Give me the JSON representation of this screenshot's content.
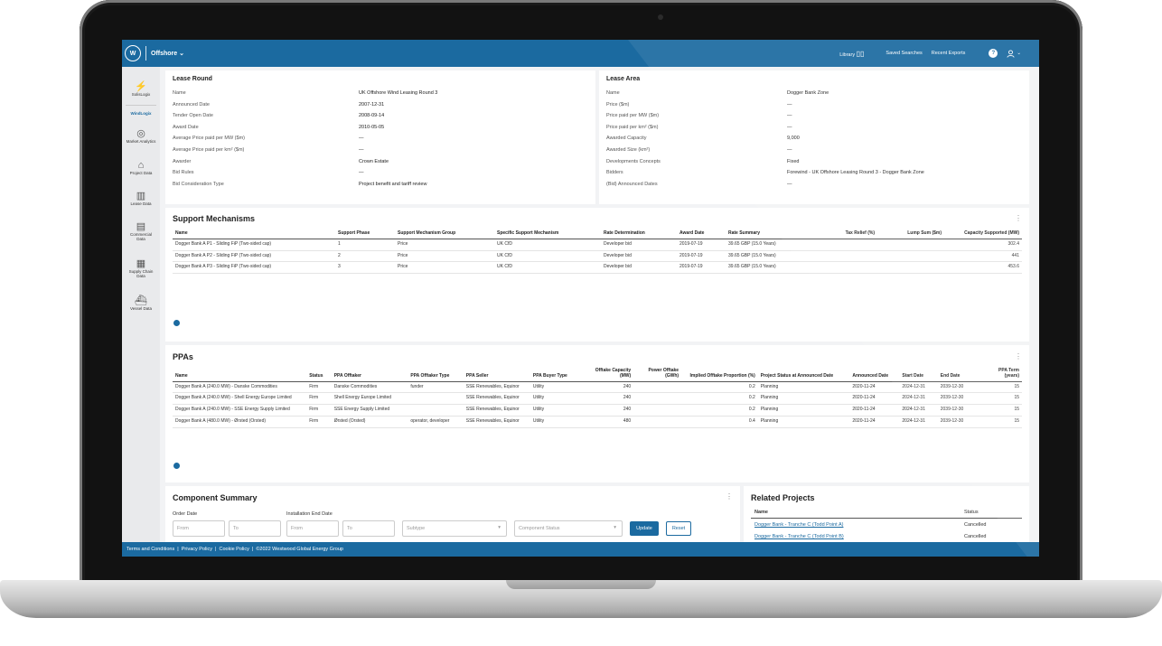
{
  "header": {
    "logo": "W",
    "app_name": "Offshore ⌄",
    "library": "Library",
    "saved_searches": "Saved Searches",
    "recent_exports": "Recent Exports",
    "help": "?",
    "user": "⌄"
  },
  "sidebar": {
    "items": [
      {
        "label": "SolisLogix",
        "icon": "solar-icon"
      },
      {
        "label": "WindLogix",
        "icon": ""
      },
      {
        "label": "Market Analytics",
        "icon": "analytics-icon"
      },
      {
        "label": "Project Data",
        "icon": "project-icon"
      },
      {
        "label": "Lease Data",
        "icon": "map-icon"
      },
      {
        "label": "Commercial Data",
        "icon": "document-icon"
      },
      {
        "label": "Supply Chain Data",
        "icon": "supply-chain-icon"
      },
      {
        "label": "Vessel Data",
        "icon": "vessel-icon"
      }
    ]
  },
  "lease_round": {
    "title": "Lease Round",
    "rows": [
      {
        "k": "Name",
        "v": "UK Offshore Wind Leasing Round 3"
      },
      {
        "k": "Announced Date",
        "v": "2007-12-31"
      },
      {
        "k": "Tender Open Date",
        "v": "2008-09-14"
      },
      {
        "k": "Award Date",
        "v": "2010-05-05"
      },
      {
        "k": "Average Price paid per MW ($m)",
        "v": "—"
      },
      {
        "k": "Average Price paid per km² ($m)",
        "v": "—"
      },
      {
        "k": "Awarder",
        "v": "Crown Estate"
      },
      {
        "k": "Bid Rules",
        "v": "—"
      },
      {
        "k": "Bid Consideration Type",
        "v": "Project benefit and tariff review"
      }
    ]
  },
  "lease_area": {
    "title": "Lease Area",
    "rows": [
      {
        "k": "Name",
        "v": "Dogger Bank Zone"
      },
      {
        "k": "Price ($m)",
        "v": "—"
      },
      {
        "k": "Price paid per MW ($m)",
        "v": "—"
      },
      {
        "k": "Price paid per km² ($m)",
        "v": "—"
      },
      {
        "k": "Awarded Capacity",
        "v": "9,000"
      },
      {
        "k": "Awarded Size (km²)",
        "v": "—"
      },
      {
        "k": "Developments Concepts",
        "v": "Fixed"
      },
      {
        "k": "Bidders",
        "v": "Forewind - UK Offshore Leasing Round 3 - Dogger Bank Zone"
      },
      {
        "k": "(Bid) Announced Dates",
        "v": "—"
      }
    ]
  },
  "support": {
    "title": "Support Mechanisms",
    "kebab": "⋮",
    "headers": [
      "Name",
      "Support Phase",
      "Support Mechanism Group",
      "Specific Support Mechanism",
      "Rate Determination",
      "Award Date",
      "Rate Summary",
      "Tax Relief (%)",
      "Lump Sum ($m)",
      "Capacity Supported (MW)"
    ],
    "rows": [
      [
        "Dogger Bank A P1 - Sliding FiP (Two-sided cap)",
        "1",
        "Price",
        "UK CfD",
        "Developer bid",
        "2019-07-19",
        "39.65 GBP (15.0 Years)",
        "",
        "",
        "302.4"
      ],
      [
        "Dogger Bank A P2 - Sliding FiP (Two-sided cap)",
        "2",
        "Price",
        "UK CfD",
        "Developer bid",
        "2019-07-19",
        "39.65 GBP (15.0 Years)",
        "",
        "",
        "441"
      ],
      [
        "Dogger Bank A P3 - Sliding FiP (Two-sided cap)",
        "3",
        "Price",
        "UK CfD",
        "Developer bid",
        "2019-07-19",
        "39.65 GBP (15.0 Years)",
        "",
        "",
        "453.6"
      ]
    ]
  },
  "ppas": {
    "title": "PPAs",
    "kebab": "⋮",
    "headers": [
      "Name",
      "Status",
      "PPA Offtaker",
      "PPA Offtaker Type",
      "PPA Seller",
      "PPA Buyer Type",
      "Offtake Capacity (MW)",
      "Power Offtake (GWh)",
      "Implied Offtake Proportion (%)",
      "Project Status at Announced Date",
      "Announced Date",
      "Start Date",
      "End Date",
      "PPA Term (years)"
    ],
    "rows": [
      [
        "Dogger Bank A (240.0 MW) - Danske Commodities",
        "Firm",
        "Danske Commodities",
        "funder",
        "SSE Renewables, Equinor",
        "Utility",
        "240",
        "",
        "0.2",
        "Planning",
        "2020-11-24",
        "2024-12-31",
        "2039-12-30",
        "15"
      ],
      [
        "Dogger Bank A (240.0 MW) - Shell Energy Europe Limited",
        "Firm",
        "Shell Energy Europe Limited",
        "",
        "SSE Renewables, Equinor",
        "Utility",
        "240",
        "",
        "0.2",
        "Planning",
        "2020-11-24",
        "2024-12-31",
        "2039-12-30",
        "15"
      ],
      [
        "Dogger Bank A (240.0 MW) - SSE Energy Supply Limited",
        "Firm",
        "SSE Energy Supply Limited",
        "",
        "SSE Renewables, Equinor",
        "Utility",
        "240",
        "",
        "0.2",
        "Planning",
        "2020-11-24",
        "2024-12-31",
        "2039-12-30",
        "15"
      ],
      [
        "Dogger Bank A (480.0 MW) - Ørsted (Orsted)",
        "Firm",
        "Ørsted (Orsted)",
        "operator, developer",
        "SSE Renewables, Equinor",
        "Utility",
        "480",
        "",
        "0.4",
        "Planning",
        "2020-11-24",
        "2024-12-31",
        "2039-12-30",
        "15"
      ]
    ]
  },
  "component": {
    "title": "Component Summary",
    "kebab": "⋮",
    "order_date": "Order Date",
    "install_end": "Installation End Date",
    "from": "From",
    "to": "To",
    "subtype": "Subtype",
    "status": "Component Status",
    "update": "Update",
    "reset": "Reset"
  },
  "related": {
    "title": "Related Projects",
    "col_name": "Name",
    "col_status": "Status",
    "rows": [
      {
        "name": "Dogger Bank - Tranche C (Todd Point A)",
        "status": "Cancelled"
      },
      {
        "name": "Dogger Bank - Tranche C (Todd Point B)",
        "status": "Cancelled"
      }
    ]
  },
  "footer": {
    "text": "Terms and Conditions  |  Privacy Policy  |  Cookie Policy  |  ©2022 Westwood Global Energy Group"
  },
  "colors": {
    "brand": "#1b6aa0"
  }
}
